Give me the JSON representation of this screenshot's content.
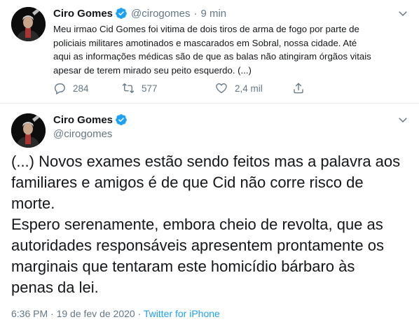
{
  "tweet1": {
    "author_name": "Ciro Gomes",
    "handle": "@cirogomes",
    "separator": "·",
    "time_ago": "9 min",
    "text_lines": [
      "Meu irmao Cid Gomes foi vitima de dois tiros de arma de fogo por parte de",
      "policiais militares amotinados e mascarados em Sobral, nossa cidade. Até",
      "aqui as informações médicas são de que as balas não atingiram órgãos vitais",
      "apesar de terem mirado seu peito esquerdo. (...)"
    ],
    "actions": {
      "replies": "284",
      "retweets": "577",
      "likes": "2,4 mil"
    }
  },
  "tweet2": {
    "author_name": "Ciro Gomes",
    "handle": "@cirogomes",
    "text_lines": [
      "(...) Novos exames estão sendo feitos mas a palavra aos",
      "familiares e amigos é de que Cid não corre risco de",
      "morte.",
      "Espero serenamente, embora cheio de revolta, que as",
      "autoridades responsáveis apresentem prontamente os",
      "marginais que tentaram este homicídio bárbaro às",
      "penas da lei."
    ],
    "timestamp": "6:36 PM · 19 de fev de 2020",
    "meta_separator": "·",
    "source": "Twitter for iPhone"
  },
  "colors": {
    "accent": "#1da1f2",
    "text": "#14171a",
    "muted": "#657786",
    "border": "#e6ecf0"
  },
  "icons": [
    "verified-badge-icon",
    "chevron-down-icon",
    "reply-icon",
    "retweet-icon",
    "like-icon",
    "share-icon"
  ]
}
